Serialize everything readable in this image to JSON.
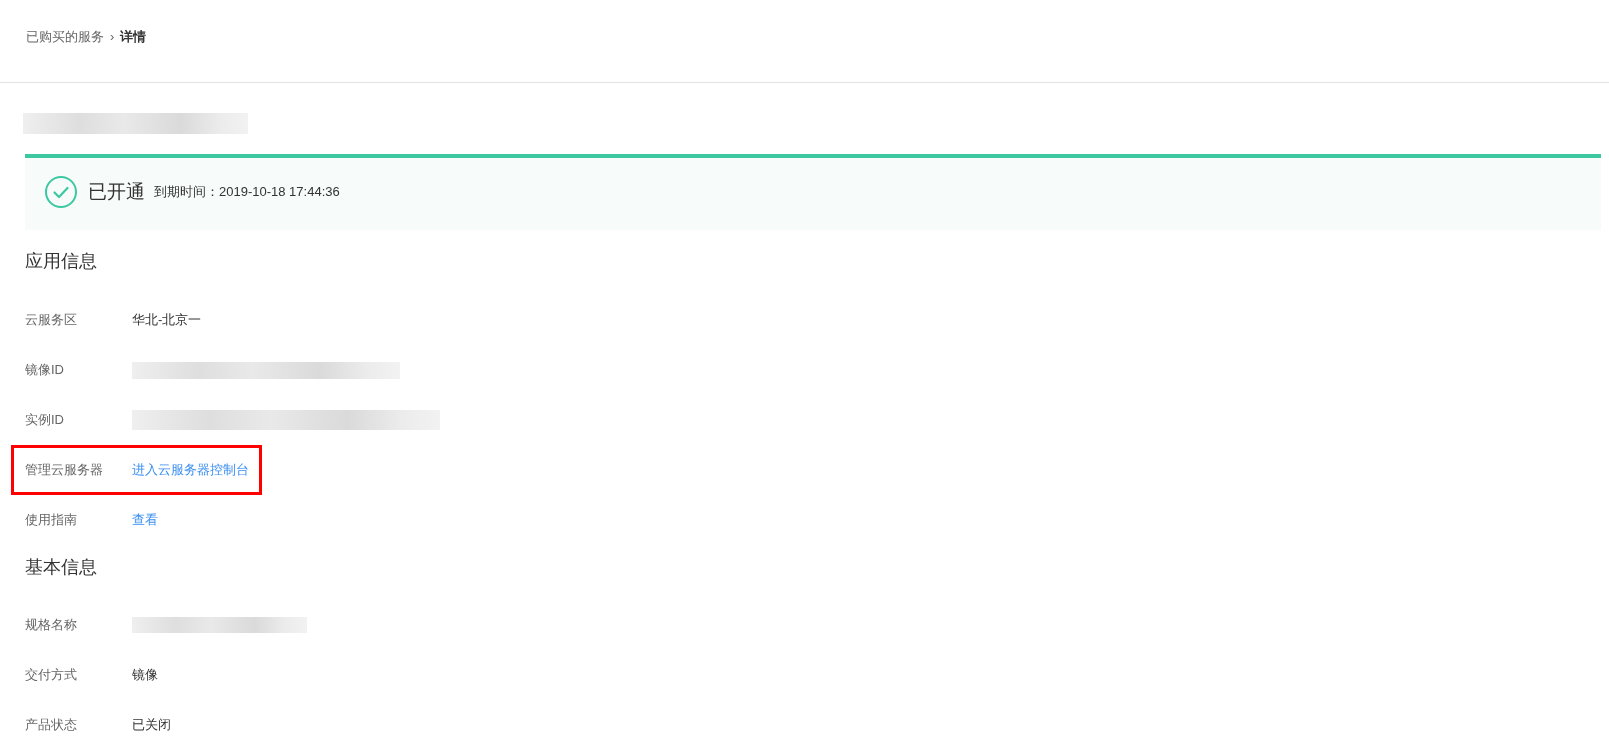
{
  "breadcrumb": {
    "separator": "›",
    "items": [
      {
        "label": "已购买的服务",
        "current": false
      },
      {
        "label": "详情",
        "current": true
      }
    ]
  },
  "title": {
    "redacted": true
  },
  "status_banner": {
    "kind": "success",
    "status": "已开通",
    "expiry": "到期时间：2019-10-18 17:44:36"
  },
  "sections": [
    {
      "heading": "应用信息",
      "rows": [
        {
          "label": "云服务区",
          "kind": "text",
          "value": "华北-北京一",
          "highlighted": false
        },
        {
          "label": "镜像ID",
          "kind": "redacted",
          "highlighted": false
        },
        {
          "label": "实例ID",
          "kind": "redacted",
          "highlighted": false
        },
        {
          "label": "管理云服务器",
          "kind": "link",
          "value": "进入云服务器控制台",
          "highlighted": true
        },
        {
          "label": "使用指南",
          "kind": "link",
          "value": "查看",
          "highlighted": false
        }
      ]
    },
    {
      "heading": "基本信息",
      "rows": [
        {
          "label": "规格名称",
          "kind": "redacted",
          "highlighted": false
        },
        {
          "label": "交付方式",
          "kind": "text",
          "value": "镜像",
          "highlighted": false
        },
        {
          "label": "产品状态",
          "kind": "text",
          "value": "已关闭",
          "highlighted": false
        }
      ]
    }
  ]
}
